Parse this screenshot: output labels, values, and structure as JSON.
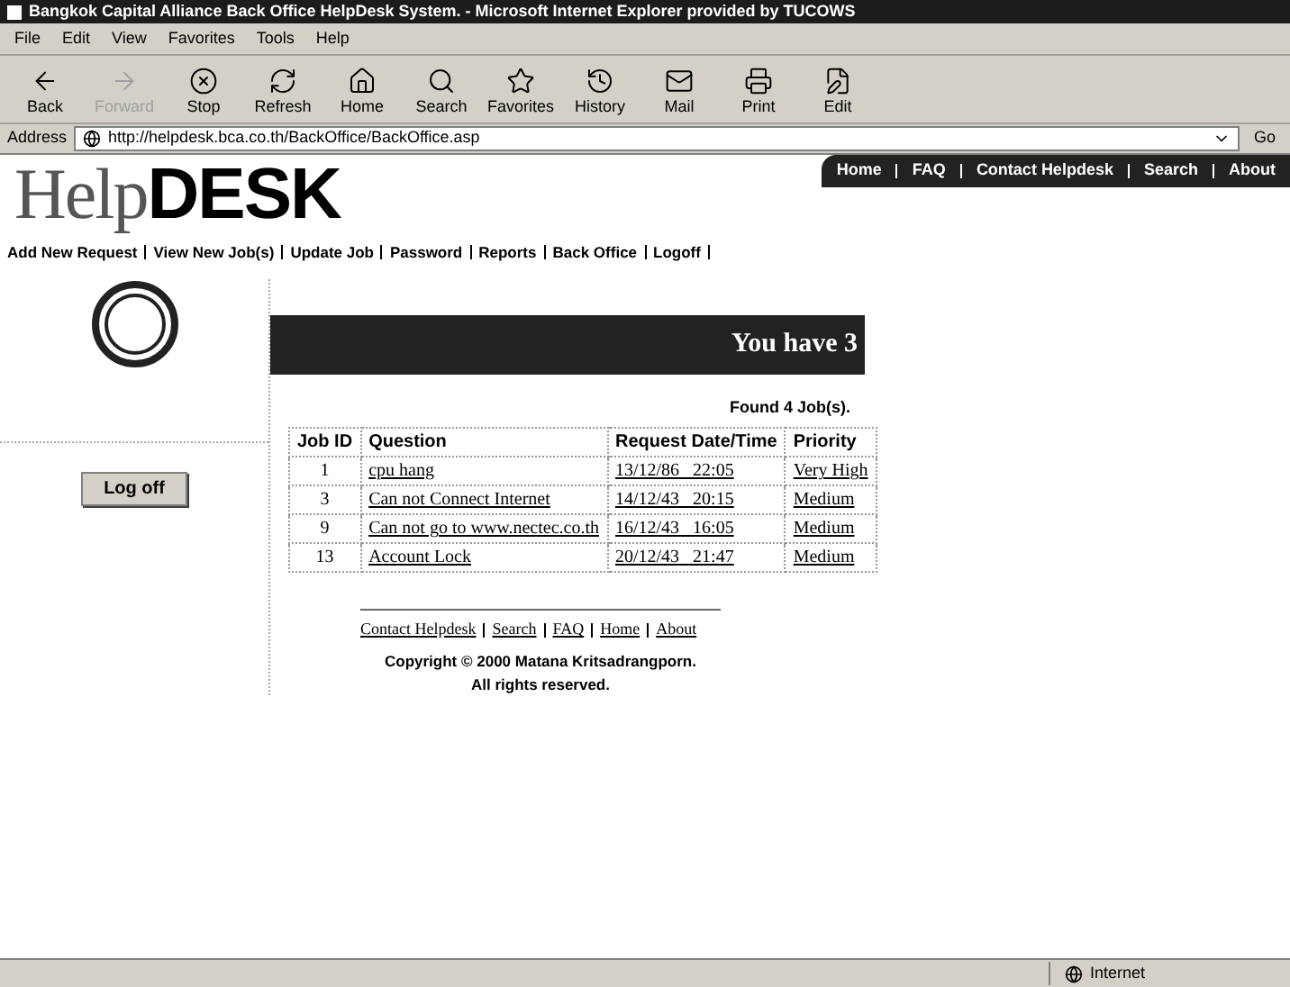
{
  "window": {
    "title": "Bangkok Capital Alliance Back Office HelpDesk System. - Microsoft Internet Explorer provided by TUCOWS"
  },
  "menu": [
    "File",
    "Edit",
    "View",
    "Favorites",
    "Tools",
    "Help"
  ],
  "toolbar": [
    {
      "label": "Back",
      "kind": "back",
      "disabled": false
    },
    {
      "label": "Forward",
      "kind": "forward",
      "disabled": true
    },
    {
      "label": "Stop",
      "kind": "stop",
      "disabled": false
    },
    {
      "label": "Refresh",
      "kind": "refresh",
      "disabled": false
    },
    {
      "label": "Home",
      "kind": "home",
      "disabled": false
    },
    {
      "label": "Search",
      "kind": "search",
      "disabled": false
    },
    {
      "label": "Favorites",
      "kind": "favorites",
      "disabled": false
    },
    {
      "label": "History",
      "kind": "history",
      "disabled": false
    },
    {
      "label": "Mail",
      "kind": "mail",
      "disabled": false
    },
    {
      "label": "Print",
      "kind": "print",
      "disabled": false
    },
    {
      "label": "Edit",
      "kind": "edit",
      "disabled": false
    }
  ],
  "address": {
    "label": "Address",
    "value": "http://helpdesk.bca.co.th/BackOffice/BackOffice.asp",
    "go": "Go"
  },
  "page": {
    "logo_light": "Help",
    "logo_bold": "DESK",
    "top_links": [
      "Home",
      "FAQ",
      "Contact Helpdesk",
      "Search",
      "About"
    ],
    "nav": [
      "Add New Request",
      "View New Job(s)",
      "Update Job",
      "Password",
      "Reports",
      "Back Office",
      "Logoff"
    ],
    "banner": "You have 3",
    "logoff_button": "Log off",
    "found": "Found 4 Job(s).",
    "table": {
      "columns": [
        "Job ID",
        "Question",
        "Request Date/Time",
        "Priority"
      ],
      "rows": [
        [
          "1",
          "cpu hang",
          "13/12/86   22:05",
          "Very High"
        ],
        [
          "3",
          "Can not Connect Internet",
          "14/12/43   20:15",
          "Medium"
        ],
        [
          "9",
          "Can not go to www.nectec.co.th",
          "16/12/43   16:05",
          "Medium"
        ],
        [
          "13",
          "Account Lock",
          "20/12/43   21:47",
          "Medium"
        ]
      ]
    },
    "footer_links": [
      "Contact Helpdesk",
      "Search",
      "FAQ",
      "Home",
      "About"
    ],
    "copyright": [
      "Copyright © 2000 Matana Kritsadrangporn.",
      "All rights reserved."
    ]
  },
  "status_bar": {
    "zone": "Internet"
  }
}
